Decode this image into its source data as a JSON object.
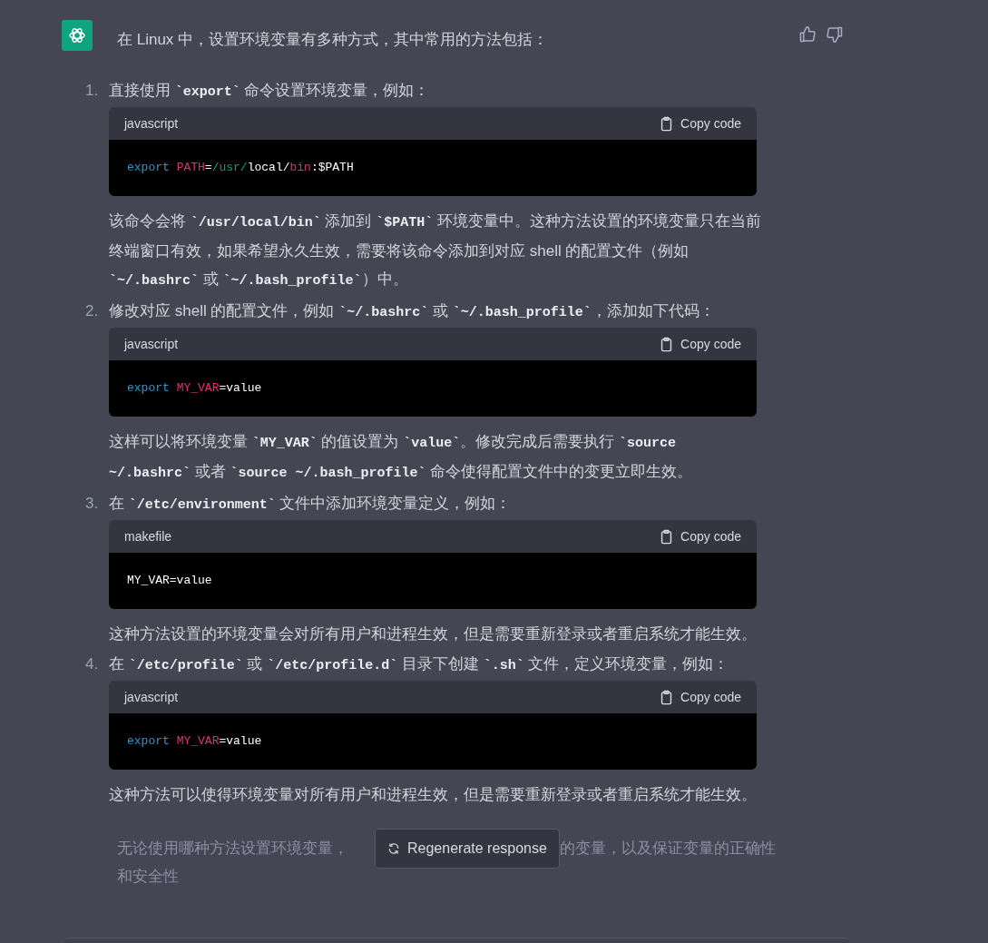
{
  "message": {
    "intro": "在 Linux 中，设置环境变量有多种方式，其中常用的方法包括：",
    "steps": [
      {
        "number": "1.",
        "text": "直接使用 **`export`** 命令设置环境变量，例如：",
        "code": {
          "language": "javascript",
          "copy_label": "Copy code",
          "tokens": [
            {
              "kind": "keyword",
              "text": "export"
            },
            {
              "kind": "variable",
              "text": "PATH"
            },
            {
              "kind": "plain",
              "text": "="
            },
            {
              "kind": "path",
              "text": "/usr/"
            },
            {
              "kind": "plain",
              "text": "local/"
            },
            {
              "kind": "variable",
              "text": "bin"
            },
            {
              "kind": "plain",
              "text": ":$PATH"
            }
          ]
        },
        "note": "该命令会将 **`/usr/local/bin`** 添加到 **`$PATH`** 环境变量中。这种方法设置的环境变量只在当前终端窗口有效，如果希望永久生效，需要将该命令添加到对应 shell 的配置文件（例如 **`~/.bashrc`** 或 **`~/.bash_profile`**）中。"
      },
      {
        "number": "2.",
        "text": "修改对应 shell 的配置文件，例如 **`~/.bashrc`** 或 **`~/.bash_profile`**，添加如下代码：",
        "code": {
          "language": "javascript",
          "copy_label": "Copy code",
          "tokens": [
            {
              "kind": "keyword",
              "text": "export"
            },
            {
              "kind": "variable",
              "text": "MY_VAR"
            },
            {
              "kind": "plain",
              "text": "=value"
            }
          ]
        },
        "note": "这样可以将环境变量 **`MY_VAR`** 的值设置为 **`value`**。修改完成后需要执行 **`source ~/.bashrc`** 或者 **`source ~/.bash_profile`** 命令使得配置文件中的变更立即生效。"
      },
      {
        "number": "3.",
        "text": "在 **`/etc/environment`** 文件中添加环境变量定义，例如：",
        "code": {
          "language": "makefile",
          "copy_label": "Copy code",
          "tokens": [
            {
              "kind": "plain",
              "text": "MY_VAR=value"
            }
          ]
        },
        "note": "这种方法设置的环境变量会对所有用户和进程生效，但是需要重新登录或者重启系统才能生效。"
      },
      {
        "number": "4.",
        "text": "在 **`/etc/profile`** 或 **`/etc/profile.d`** 目录下创建 **`.sh`** 文件，定义环境变量，例如：",
        "code": {
          "language": "javascript",
          "copy_label": "Copy code",
          "tokens": [
            {
              "kind": "keyword",
              "text": "export"
            },
            {
              "kind": "variable",
              "text": "MY_VAR"
            },
            {
              "kind": "plain",
              "text": "=value"
            }
          ]
        },
        "note": "这种方法可以使得环境变量对所有用户和进程生效，但是需要重新登录或者重启系统才能生效。"
      }
    ],
    "closing": [
      "无论使用哪种方法设置环境变量，",
      "的变量，以及保证变量的正确性",
      "和安全性"
    ]
  },
  "regenerate_button": "Regenerate response"
}
